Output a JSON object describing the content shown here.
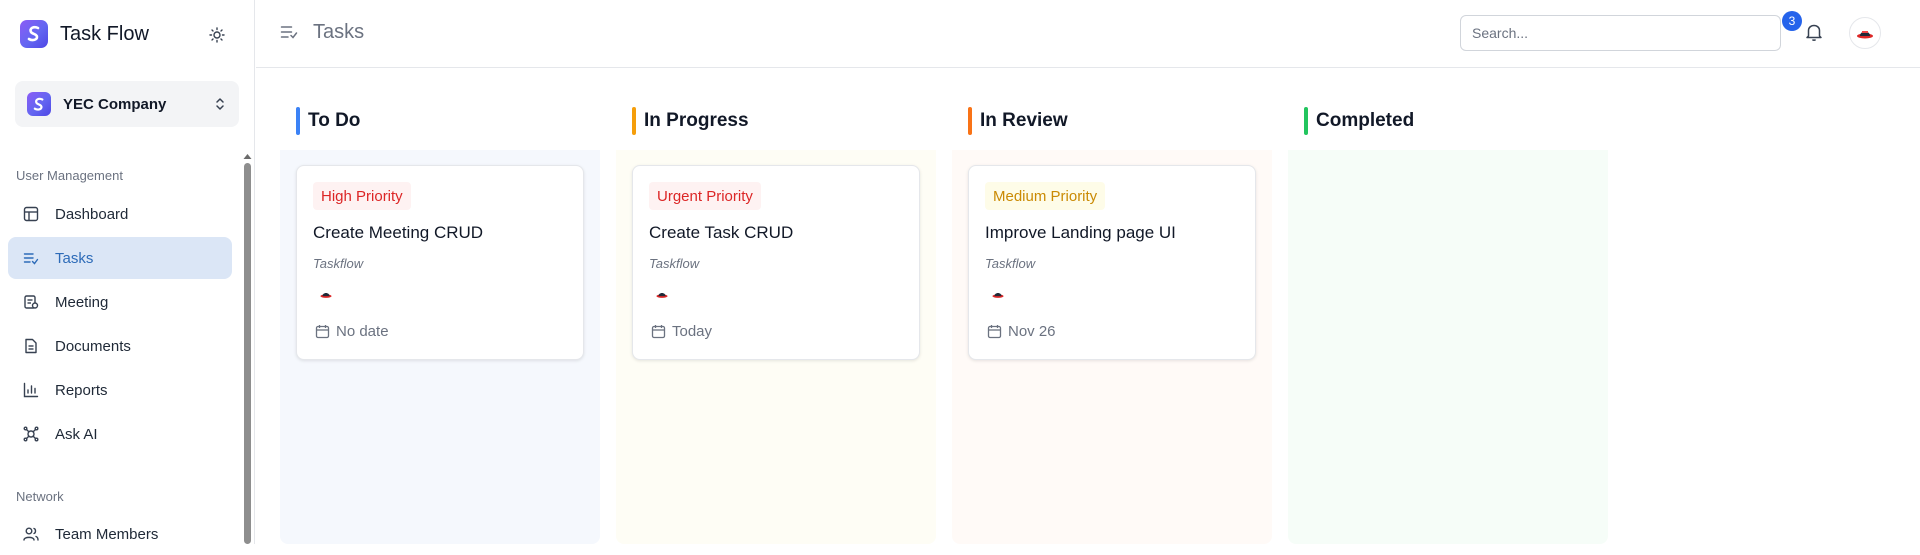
{
  "app": {
    "name": "Task Flow"
  },
  "company": {
    "name": "YEC Company"
  },
  "sidebar": {
    "sections": [
      {
        "label": "User Management"
      },
      {
        "label": "Network"
      }
    ],
    "items": [
      {
        "label": "Dashboard",
        "icon": "dashboard-icon",
        "active": false
      },
      {
        "label": "Tasks",
        "icon": "tasks-icon",
        "active": true
      },
      {
        "label": "Meeting",
        "icon": "meeting-icon",
        "active": false
      },
      {
        "label": "Documents",
        "icon": "documents-icon",
        "active": false
      },
      {
        "label": "Reports",
        "icon": "reports-icon",
        "active": false
      },
      {
        "label": "Ask AI",
        "icon": "ask-ai-icon",
        "active": false
      },
      {
        "label": "Team Members",
        "icon": "team-members-icon",
        "active": false
      }
    ]
  },
  "header": {
    "title": "Tasks",
    "search_placeholder": "Search...",
    "notifications_count": "3"
  },
  "board": {
    "columns": [
      {
        "title": "To Do",
        "accent": "#3b82f6",
        "bg": "#f5f8fd",
        "cards": [
          {
            "priority": "High Priority",
            "title": "Create Meeting CRUD",
            "project": "Taskflow",
            "due": "No date"
          }
        ]
      },
      {
        "title": "In Progress",
        "accent": "#f59e0b",
        "bg": "#fefdf5",
        "cards": [
          {
            "priority": "Urgent Priority",
            "title": "Create Task CRUD",
            "project": "Taskflow",
            "due": "Today"
          }
        ]
      },
      {
        "title": "In Review",
        "accent": "#f97316",
        "bg": "#fffaf7",
        "cards": [
          {
            "priority": "Medium Priority",
            "title": "Improve Landing page UI",
            "project": "Taskflow",
            "due": "Nov 26"
          }
        ]
      },
      {
        "title": "Completed",
        "accent": "#22c55e",
        "bg": "#f6fdf8",
        "cards": []
      }
    ]
  },
  "colors": {
    "high_priority_text": "#dc2626",
    "high_priority_bg": "#fef2f2",
    "urgent_priority_text": "#dc2626",
    "urgent_priority_bg": "#fef2f2",
    "medium_priority_text": "#ca8a04",
    "medium_priority_bg": "#fefce8",
    "active_nav_bg": "#dbe6f6",
    "active_nav_text": "#2d6bb8",
    "badge": "#2563eb"
  }
}
